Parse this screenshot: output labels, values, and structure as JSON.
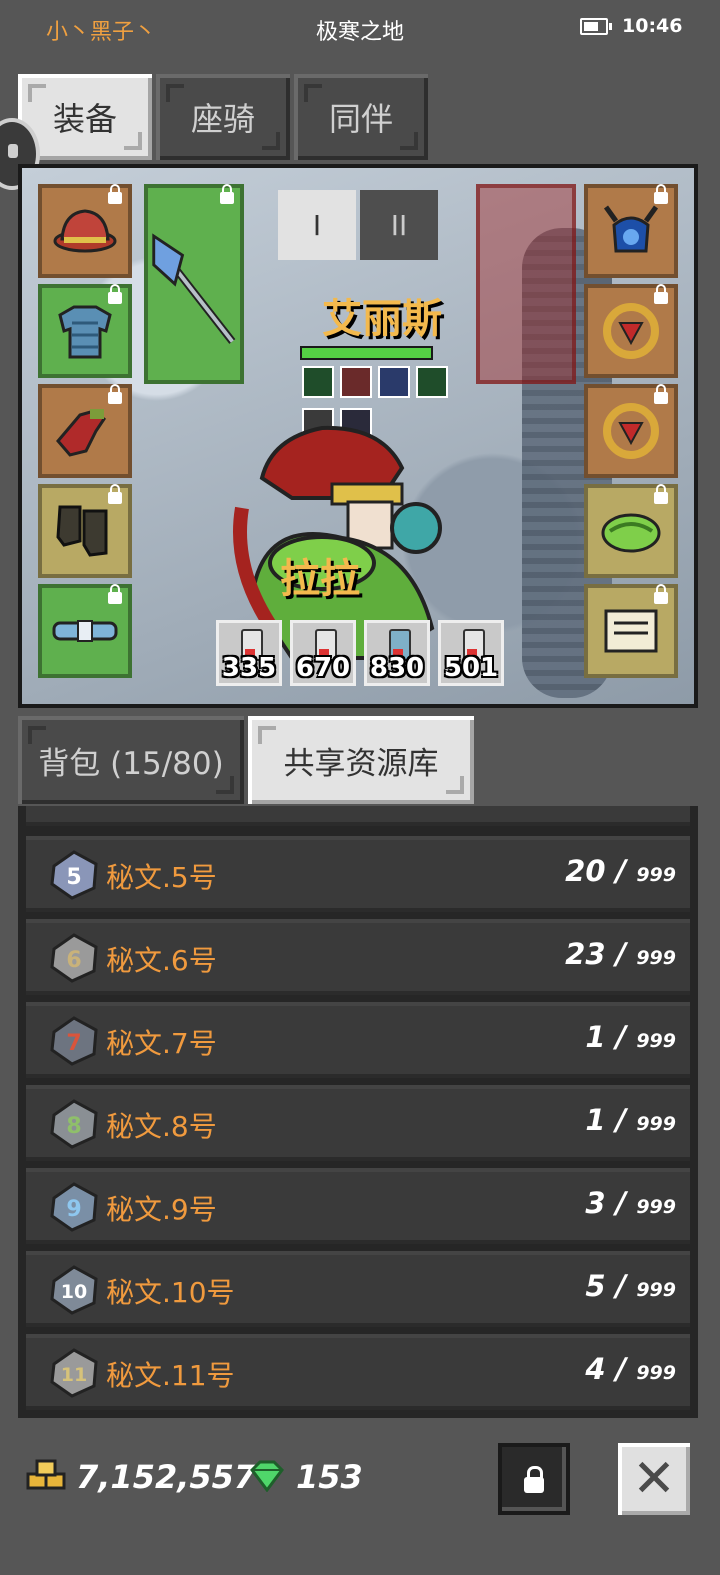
{
  "status": {
    "player_name": "小丶黑子丶",
    "map_name": "极寒之地",
    "time": "10:46"
  },
  "main_tabs": [
    {
      "label": "装备",
      "active": true
    },
    {
      "label": "座骑",
      "active": false
    },
    {
      "label": "同伴",
      "active": false
    }
  ],
  "equipment": {
    "set_buttons": [
      "I",
      "II"
    ],
    "active_set": "I",
    "hero_name": "艾丽斯",
    "mount_name": "拉拉",
    "hp_fraction": 0.85,
    "left_slots": [
      {
        "icon": "red-hat-icon",
        "rarity": "orange"
      },
      {
        "icon": "blue-armor-icon",
        "rarity": "green"
      },
      {
        "icon": "red-gloves-icon",
        "rarity": "orange"
      },
      {
        "icon": "boots-icon",
        "rarity": "yellow"
      },
      {
        "icon": "belt-icon",
        "rarity": "green"
      }
    ],
    "weapon_slot": {
      "icon": "halberd-icon",
      "rarity": "green"
    },
    "right_slots": [
      {
        "icon": "horned-helm-icon",
        "rarity": "orange"
      },
      {
        "icon": "ruby-ring-icon",
        "rarity": "orange"
      },
      {
        "icon": "ruby-ring-icon",
        "rarity": "orange"
      },
      {
        "icon": "serpent-mount-icon",
        "rarity": "yellow"
      },
      {
        "icon": "scroll-icon",
        "rarity": "yellow"
      }
    ],
    "potions": [
      {
        "count": "335"
      },
      {
        "count": "670"
      },
      {
        "count": "830"
      },
      {
        "count": "501"
      }
    ]
  },
  "inventory_tabs": [
    {
      "label": "背包 (15/80)",
      "active": false
    },
    {
      "label": "共享资源库",
      "active": true
    }
  ],
  "resources": [
    {
      "name": "秘文.5号",
      "count": "20 /",
      "max": "999",
      "color": "#8a96b8",
      "digit": "5"
    },
    {
      "name": "秘文.6号",
      "count": "23 /",
      "max": "999",
      "color": "#c9b27a",
      "digit": "6"
    },
    {
      "name": "秘文.7号",
      "count": "1 /",
      "max": "999",
      "color": "#d9553c",
      "digit": "7"
    },
    {
      "name": "秘文.8号",
      "count": "1 /",
      "max": "999",
      "color": "#8fbf6a",
      "digit": "8"
    },
    {
      "name": "秘文.9号",
      "count": "3 /",
      "max": "999",
      "color": "#8ec7ef",
      "digit": "9"
    },
    {
      "name": "秘文.10号",
      "count": "5 /",
      "max": "999",
      "color": "#b9c6d6",
      "digit": "10"
    },
    {
      "name": "秘文.11号",
      "count": "4 /",
      "max": "999",
      "color": "#d6c27a",
      "digit": "11"
    }
  ],
  "currency": {
    "gold": "7,152,557",
    "gems": "153"
  },
  "colors": {
    "accent_orange": "#f09a3e",
    "hero_name": "#f3b94d"
  }
}
